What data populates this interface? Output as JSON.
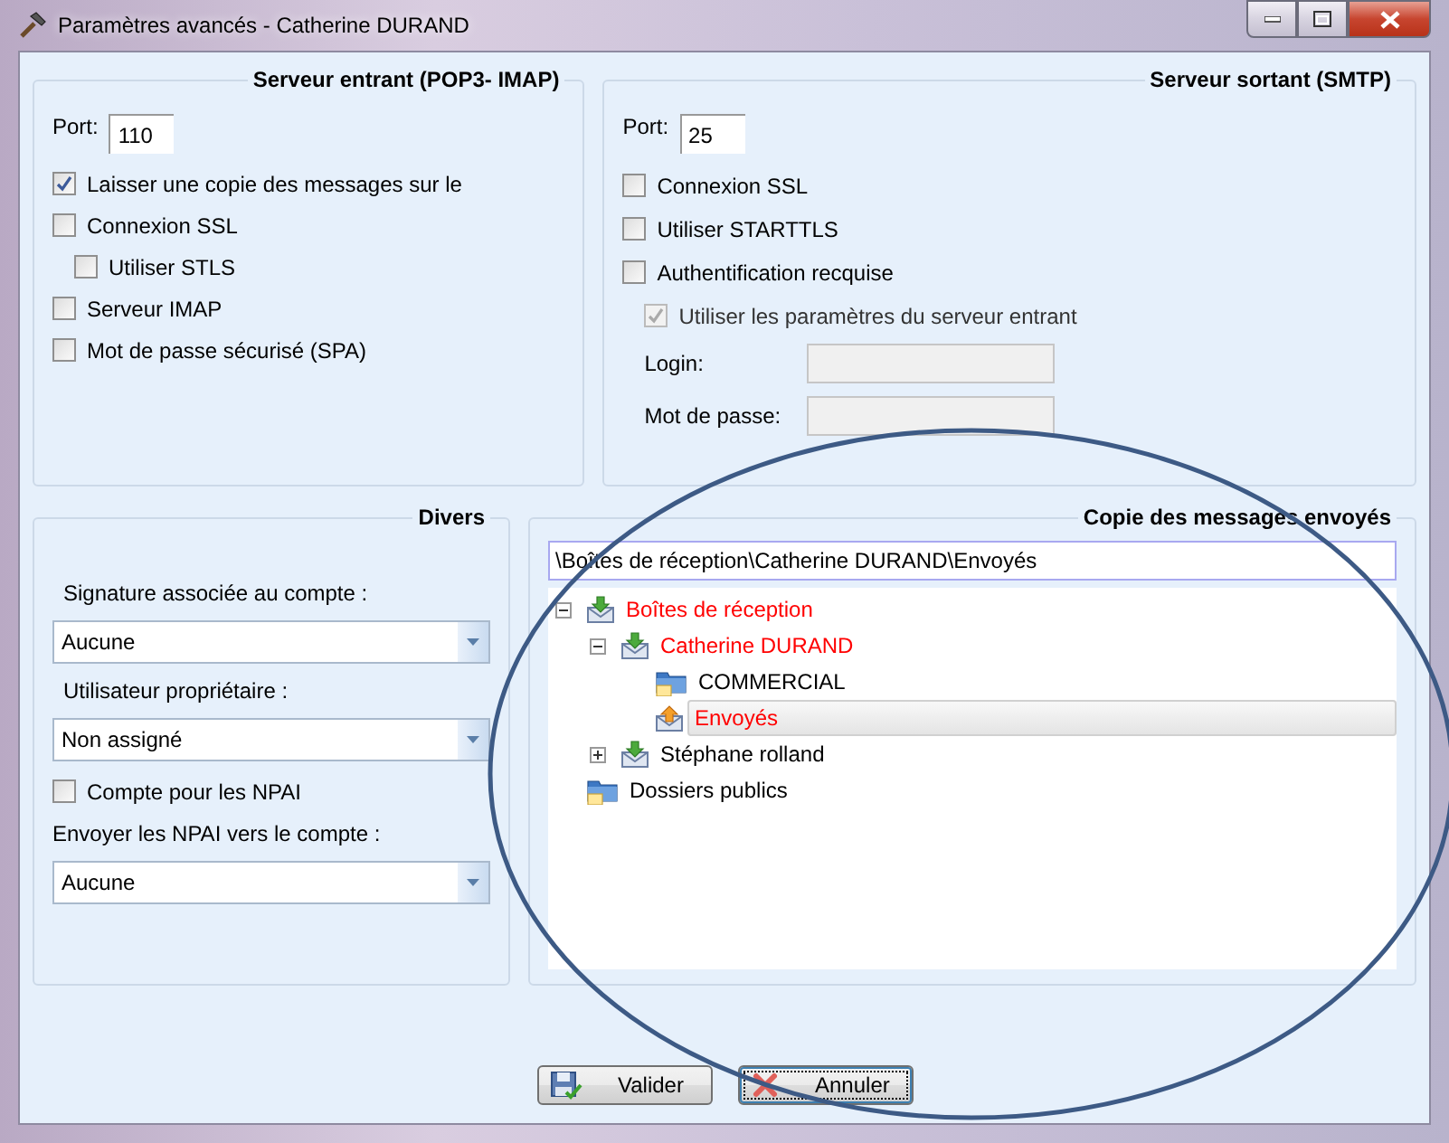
{
  "window": {
    "title": "Paramètres avancés - Catherine DURAND"
  },
  "incoming": {
    "title": "Serveur entrant (POP3- IMAP)",
    "port_label": "Port:",
    "port": "110",
    "options": [
      {
        "label": "Laisser une copie des messages sur le",
        "checked": true
      },
      {
        "label": "Connexion SSL",
        "checked": false,
        "children": [
          {
            "label": "Utiliser STLS",
            "checked": false
          }
        ]
      },
      {
        "label": "Serveur IMAP",
        "checked": false
      },
      {
        "label": "Mot de passe sécurisé (SPA)",
        "checked": false
      }
    ]
  },
  "outgoing": {
    "title": "Serveur sortant (SMTP)",
    "port_label": "Port:",
    "port": "25",
    "options": [
      {
        "label": "Connexion SSL",
        "checked": false
      },
      {
        "label": "Utiliser STARTTLS",
        "checked": false
      },
      {
        "label": "Authentification recquise",
        "checked": false,
        "children": [
          {
            "label": "Utiliser les paramètres du serveur entrant",
            "checked": true,
            "disabled": true
          }
        ]
      }
    ],
    "fields": [
      {
        "label": "Login:",
        "disabled": true
      },
      {
        "label": "Mot de passe:",
        "disabled": true
      }
    ]
  },
  "misc": {
    "title": "Divers",
    "items": [
      {
        "kind": "select",
        "label": "Signature associée au compte :",
        "value": "Aucune"
      },
      {
        "kind": "select",
        "label": "Utilisateur propriétaire :",
        "value": "Non assigné"
      },
      {
        "kind": "checkbox",
        "label": "Compte pour les NPAI",
        "checked": false
      },
      {
        "kind": "select",
        "label": "Envoyer les NPAI vers le compte :",
        "value": "Aucune"
      }
    ]
  },
  "sent_copy": {
    "title": "Copie des messages envoyés",
    "path": "\\Boîtes de réception\\Catherine DURAND\\Envoyés",
    "tree": [
      {
        "label": "Boîtes de réception",
        "kind": "inbox",
        "highlighted": true,
        "selected": false,
        "expanded": true,
        "children": [
          {
            "label": "Catherine DURAND",
            "kind": "inbox",
            "highlighted": true,
            "selected": false,
            "expanded": true,
            "children": [
              {
                "label": "COMMERCIAL",
                "kind": "folder",
                "highlighted": false,
                "selected": false
              },
              {
                "label": "Envoyés",
                "kind": "sent",
                "highlighted": true,
                "selected": true
              }
            ]
          },
          {
            "label": "Stéphane rolland",
            "kind": "inbox",
            "highlighted": false,
            "selected": false,
            "expanded": false
          }
        ]
      },
      {
        "label": "Dossiers publics",
        "kind": "folder",
        "highlighted": false,
        "selected": false
      }
    ]
  },
  "buttons": [
    {
      "label": "Valider",
      "kind": "save",
      "focused": false
    },
    {
      "label": "Annuler",
      "kind": "cancel",
      "focused": true
    }
  ]
}
